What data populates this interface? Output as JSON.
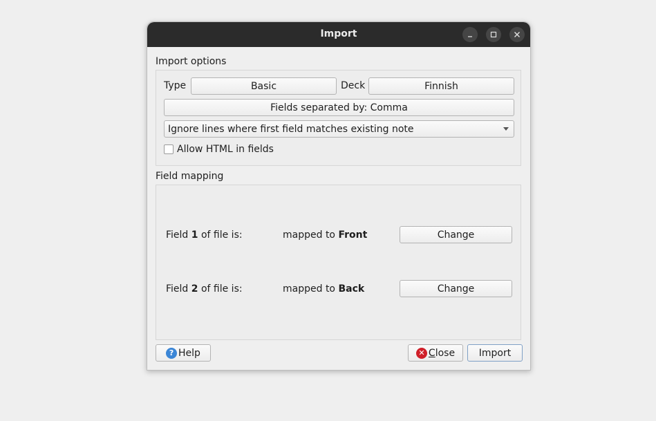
{
  "window": {
    "title": "Import"
  },
  "import_options": {
    "group_label": "Import options",
    "type_label": "Type",
    "type_value": "Basic",
    "deck_label": "Deck",
    "deck_value": "Finnish",
    "separator_button": "Fields separated by: Comma",
    "duplicate_mode": "Ignore lines where first field matches existing note",
    "allow_html_label": "Allow HTML in fields",
    "allow_html_checked": false
  },
  "field_mapping": {
    "group_label": "Field mapping",
    "rows": [
      {
        "prefix": "Field ",
        "num": "1",
        "suffix": " of file is:",
        "mapped_prefix": "mapped to ",
        "mapped_field": "Front",
        "button": "Change"
      },
      {
        "prefix": "Field ",
        "num": "2",
        "suffix": " of file is:",
        "mapped_prefix": "mapped to ",
        "mapped_field": "Back",
        "button": "Change"
      }
    ]
  },
  "footer": {
    "help_label": "Help",
    "close_label_underlined": "C",
    "close_label_rest": "lose",
    "import_label": "Import"
  },
  "colors": {
    "titlebar": "#2b2b2b",
    "help_icon": "#3b86d6",
    "close_icon": "#d0202a"
  }
}
